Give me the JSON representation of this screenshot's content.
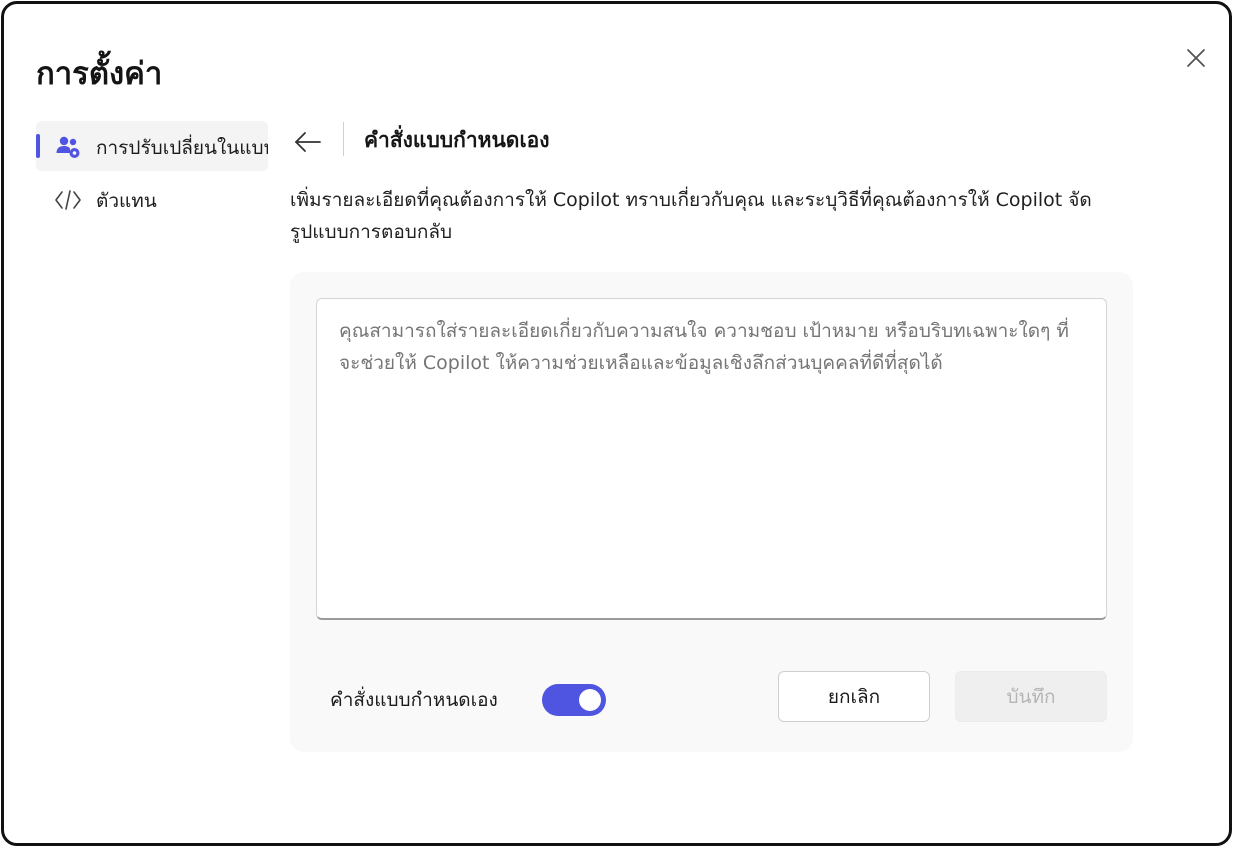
{
  "window": {
    "title": "การตั้งค่า"
  },
  "sidebar": {
    "items": [
      {
        "label": "การปรับเปลี่ยนในแบบของคุณ",
        "icon": "people-settings-icon",
        "active": true
      },
      {
        "label": "ตัวแทน",
        "icon": "code-icon",
        "active": false
      }
    ]
  },
  "content": {
    "title": "คำสั่งแบบกำหนดเอง",
    "description": "เพิ่มรายละเอียดที่คุณต้องการให้ Copilot ทราบเกี่ยวกับคุณ และระบุวิธีที่คุณต้องการให้ Copilot จัดรูปแบบการตอบกลับ",
    "textarea_placeholder": "คุณสามารถใส่รายละเอียดเกี่ยวกับความสนใจ ความชอบ เป้าหมาย หรือบริบทเฉพาะใดๆ ที่จะช่วยให้ Copilot ให้ความช่วยเหลือและข้อมูลเชิงลึกส่วนบุคคลที่ดีที่สุดได้",
    "textarea_value": "",
    "toggle_label": "คำสั่งแบบกำหนดเอง",
    "toggle_on": true,
    "cancel_label": "ยกเลิก",
    "save_label": "บันทึก"
  },
  "colors": {
    "accent": "#4f55e0",
    "panel_bg": "#f9f9f9",
    "disabled_text": "#b5b5b5"
  }
}
